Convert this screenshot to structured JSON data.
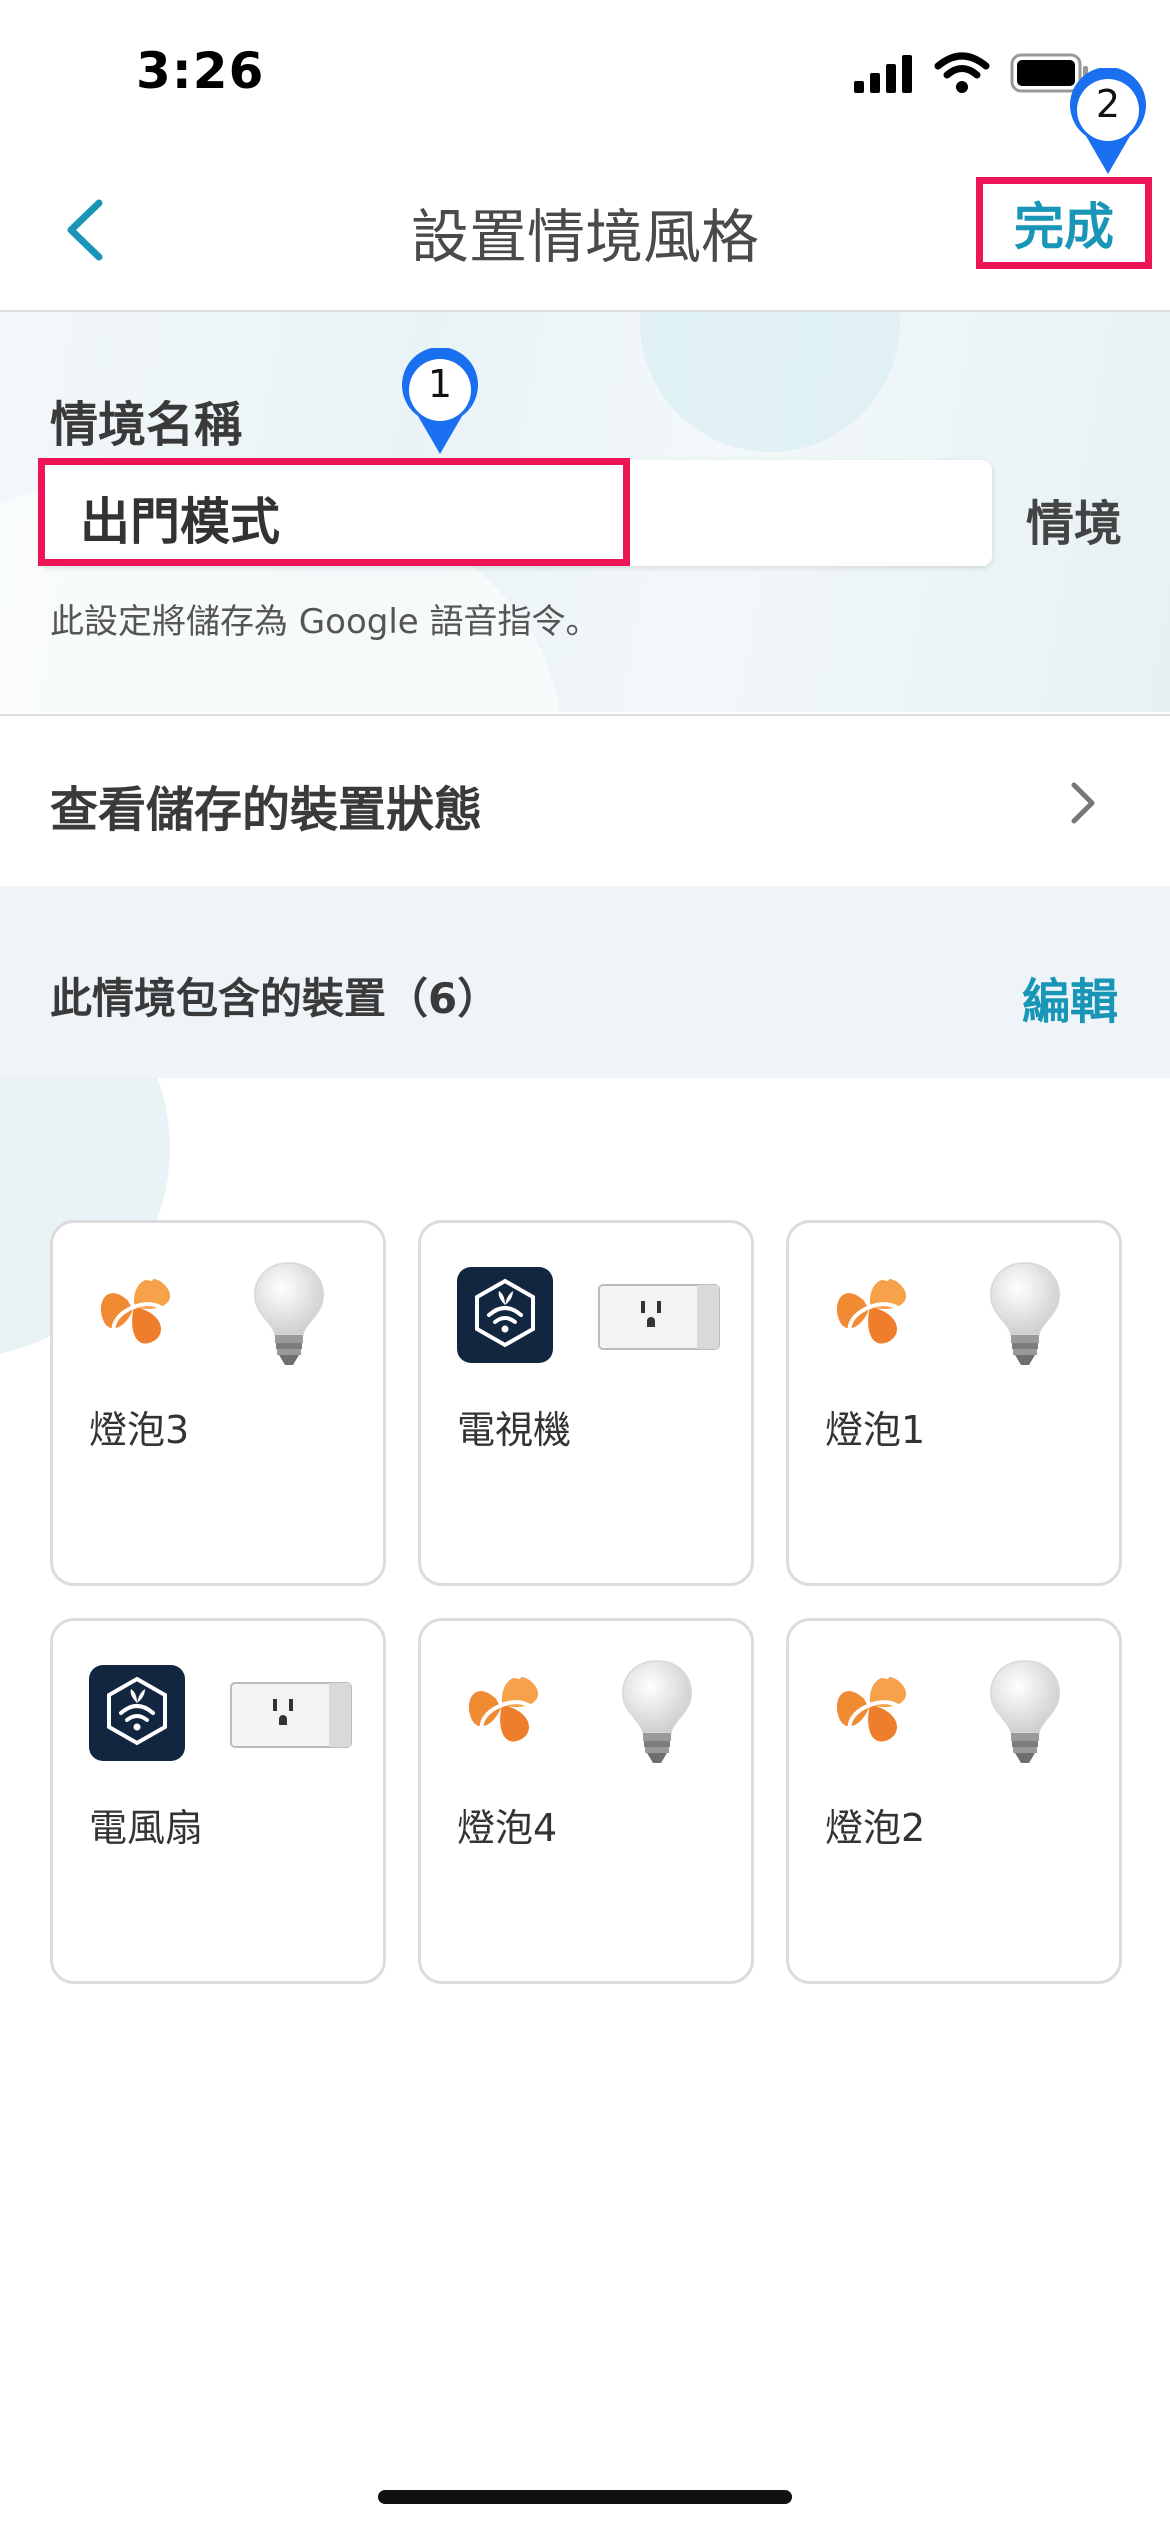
{
  "status_bar": {
    "time": "3:26"
  },
  "nav": {
    "title": "設置情境風格",
    "done_label": "完成"
  },
  "scene_name": {
    "label": "情境名稱",
    "value": "出門模式",
    "suffix": "情境",
    "hint": "此設定將儲存為 Google 語音指令。"
  },
  "saved_state_row": {
    "label": "查看儲存的裝置狀態"
  },
  "devices_section": {
    "label": "此情境包含的裝置（6）",
    "edit_label": "編輯"
  },
  "devices": [
    {
      "name": "燈泡3",
      "brand_icon": "flower-brand-icon",
      "device_icon": "light-bulb-icon"
    },
    {
      "name": "電視機",
      "brand_icon": "wifi-hex-brand-icon",
      "device_icon": "smart-plug-icon"
    },
    {
      "name": "燈泡1",
      "brand_icon": "flower-brand-icon",
      "device_icon": "light-bulb-icon"
    },
    {
      "name": "電風扇",
      "brand_icon": "wifi-hex-brand-icon",
      "device_icon": "smart-plug-icon"
    },
    {
      "name": "燈泡4",
      "brand_icon": "flower-brand-icon",
      "device_icon": "light-bulb-icon"
    },
    {
      "name": "燈泡2",
      "brand_icon": "flower-brand-icon",
      "device_icon": "light-bulb-icon"
    }
  ],
  "annotations": [
    {
      "number": "1"
    },
    {
      "number": "2"
    }
  ],
  "colors": {
    "accent": "#1996b7",
    "highlight": "#ed1556",
    "marker": "#1a6ff0"
  }
}
